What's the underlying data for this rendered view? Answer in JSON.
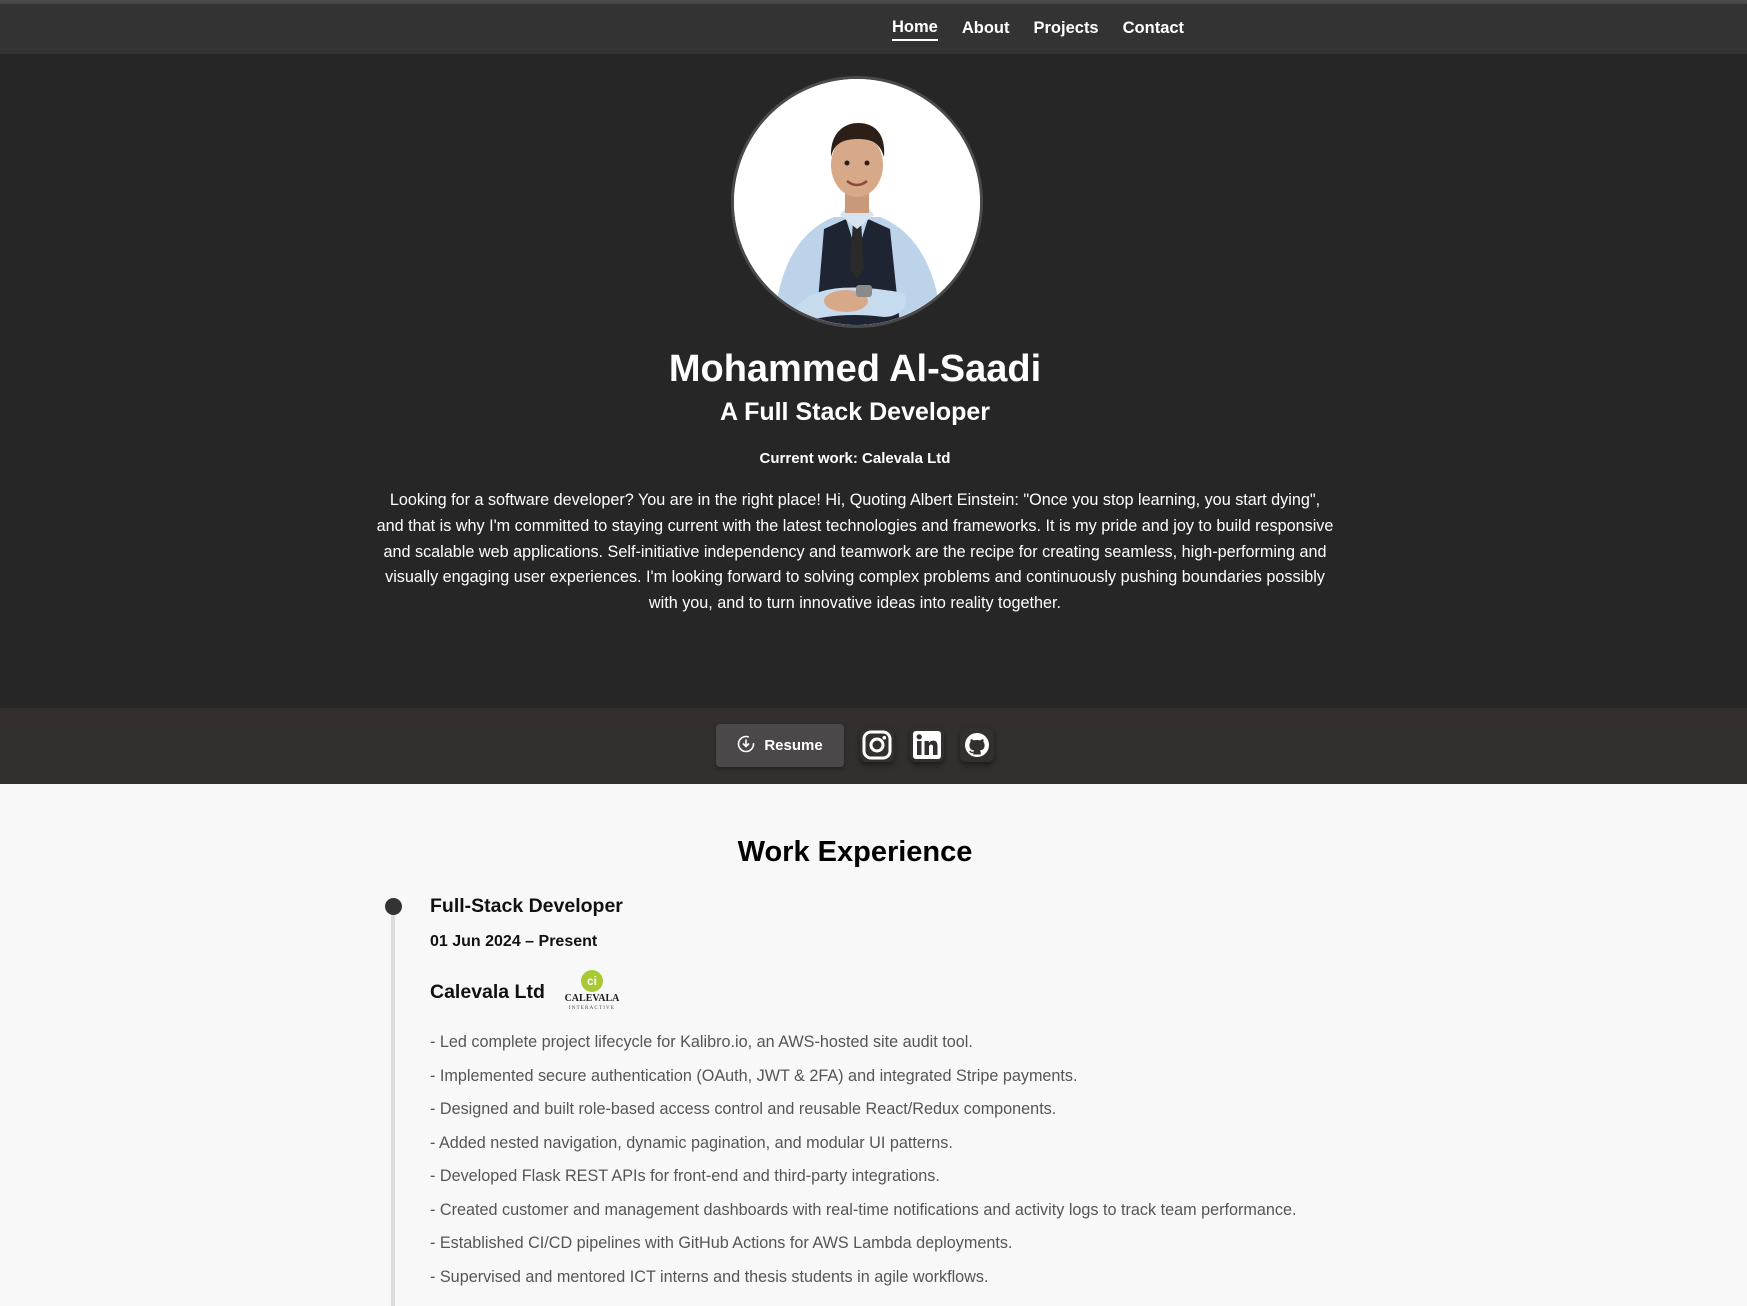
{
  "nav": {
    "items": [
      {
        "label": "Home",
        "active": true
      },
      {
        "label": "About",
        "active": false
      },
      {
        "label": "Projects",
        "active": false
      },
      {
        "label": "Contact",
        "active": false
      }
    ]
  },
  "hero": {
    "name": "Mohammed Al-Saadi",
    "role": "A Full Stack Developer",
    "current_work": "Current work: Calevala Ltd",
    "bio": "Looking for a software developer? You are in the right place! Hi, Quoting Albert Einstein: \"Once you stop learning, you start dying\", and that is why I'm committed to staying current with the latest technologies and frameworks. It is my pride and joy to build responsive and scalable web applications. Self-initiative independency and teamwork are the recipe for creating seamless, high-performing and visually engaging user experiences. I'm looking forward to solving complex problems and continuously pushing boundaries possibly with you, and to turn innovative ideas into reality together."
  },
  "social": {
    "resume_label": "Resume",
    "icons": [
      "download-icon",
      "instagram-icon",
      "linkedin-icon",
      "github-icon"
    ]
  },
  "work": {
    "section_title": "Work Experience",
    "jobs": [
      {
        "title": "Full-Stack Developer",
        "dates": "01 Jun 2024 – Present",
        "company": "Calevala Ltd",
        "logo": {
          "mark": "ci",
          "name": "CALEVALA",
          "tagline": "INTERACTIVE"
        },
        "duties": [
          "- Led complete project lifecycle for Kalibro.io, an AWS-hosted site audit tool.",
          "- Implemented secure authentication (OAuth, JWT & 2FA) and integrated Stripe payments.",
          "- Designed and built role-based access control and reusable React/Redux components.",
          "- Added nested navigation, dynamic pagination, and modular UI patterns.",
          "- Developed Flask REST APIs for front-end and third-party integrations.",
          "- Created customer and management dashboards with real-time notifications and activity logs to track team performance.",
          "- Established CI/CD pipelines with GitHub Actions for AWS Lambda deployments.",
          "- Supervised and mentored ICT interns and thesis students in agile workflows."
        ]
      }
    ]
  },
  "colors": {
    "nav_bg": "#333333",
    "hero_bg": "#262626",
    "social_bar_bg": "#332f2f",
    "page_bg": "#f8f8f8",
    "logo_green": "#a8c834"
  }
}
